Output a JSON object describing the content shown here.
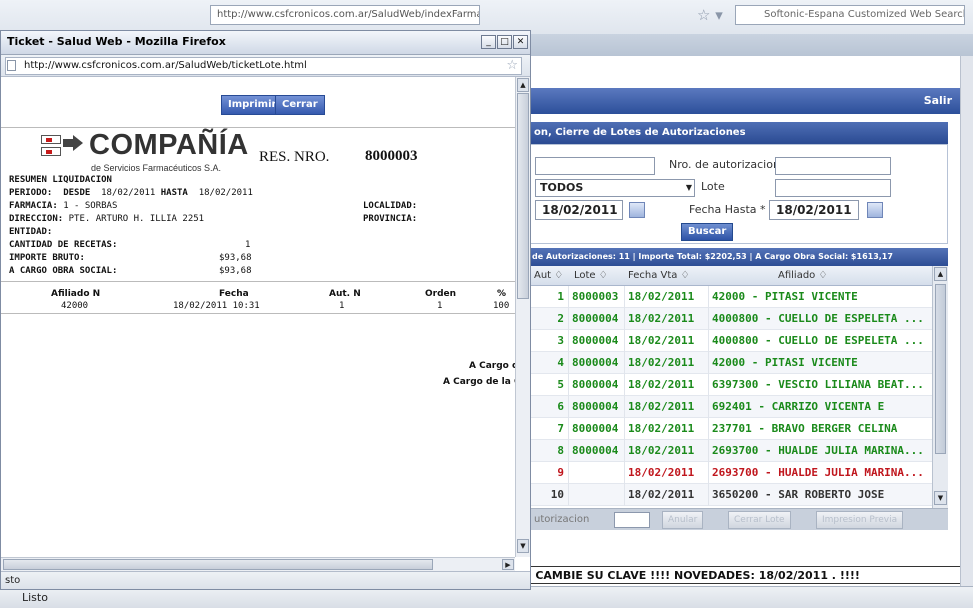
{
  "browser": {
    "url_fragment": "http://www.csfcronicos.com.ar/SaludWeb/indexFarmacia.html",
    "search_placeholder": "Softonic-Espana Customized Web Search",
    "status": "Listo"
  },
  "app": {
    "salir_label": "Salir",
    "panel_title": "on, Cierre de Lotes de Autorizaciones",
    "filters": {
      "nro_autorizacion_label": "Nro. de autorizacion",
      "select_value": "TODOS",
      "lote_label": "Lote",
      "fecha_desde_value": "18/02/2011",
      "fecha_hasta_label": "Fecha Hasta *",
      "fecha_hasta_value": "18/02/2011",
      "buscar_label": "Buscar"
    },
    "grid_title": "de Autorizaciones: 11 | Importe Total: $2202,53 | A Cargo Obra Social: $1613,17",
    "grid_columns": [
      "Aut ♢",
      "Lote ♢",
      "Fecha Vta ♢",
      "Afiliado ♢"
    ],
    "grid_rows": [
      {
        "aut": "1",
        "lote": "8000003",
        "fecha": "18/02/2011",
        "afiliado": "42000 - PITASI VICENTE",
        "status": "green"
      },
      {
        "aut": "2",
        "lote": "8000004",
        "fecha": "18/02/2011",
        "afiliado": "4000800 - CUELLO DE ESPELETA ...",
        "status": "green"
      },
      {
        "aut": "3",
        "lote": "8000004",
        "fecha": "18/02/2011",
        "afiliado": "4000800 - CUELLO DE ESPELETA ...",
        "status": "green"
      },
      {
        "aut": "4",
        "lote": "8000004",
        "fecha": "18/02/2011",
        "afiliado": "42000 - PITASI VICENTE",
        "status": "green"
      },
      {
        "aut": "5",
        "lote": "8000004",
        "fecha": "18/02/2011",
        "afiliado": "6397300 - VESCIO LILIANA BEAT...",
        "status": "green"
      },
      {
        "aut": "6",
        "lote": "8000004",
        "fecha": "18/02/2011",
        "afiliado": "692401 - CARRIZO VICENTA E",
        "status": "green"
      },
      {
        "aut": "7",
        "lote": "8000004",
        "fecha": "18/02/2011",
        "afiliado": "237701 - BRAVO BERGER CELINA",
        "status": "green"
      },
      {
        "aut": "8",
        "lote": "8000004",
        "fecha": "18/02/2011",
        "afiliado": "2693700 - HUALDE JULIA MARINA...",
        "status": "green"
      },
      {
        "aut": "9",
        "lote": "",
        "fecha": "18/02/2011",
        "afiliado": "2693700 - HUALDE JULIA MARINA...",
        "status": "red"
      },
      {
        "aut": "10",
        "lote": "",
        "fecha": "18/02/2011",
        "afiliado": "3650200 - SAR ROBERTO JOSE",
        "status": "dark"
      }
    ],
    "grid_footer": {
      "autorizacion_label": "utorizacion",
      "btn1": "Anular",
      "btn2": "Cerrar Lote",
      "btn3": "Impresion Previa"
    },
    "ticker": "E CAMBIE SU CLAVE !!!!     NOVEDADES: 18/02/2011 .  !!!!"
  },
  "popup": {
    "title": "Ticket - Salud Web - Mozilla Firefox",
    "url": "http://www.csfcronicos.com.ar/SaludWeb/ticketLote.html",
    "status": "sto",
    "imprimir_label": "Imprimir",
    "cerrar_label": "Cerrar",
    "company": "COMPAÑÍA",
    "company_sub": "de Servicios Farmacéuticos S.A.",
    "res_label": "RES. NRO.",
    "res_number": "8000003",
    "resumen": "RESUMEN LIQUIDACION",
    "periodo_label": "PERIODO:",
    "desde_label": "DESDE",
    "desde_value": "18/02/2011",
    "hasta_label": "HASTA",
    "hasta_value": "18/02/2011",
    "farmacia_label": "FARMACIA:",
    "farmacia_value": "1 - SORBAS",
    "direccion_label": "DIRECCION:",
    "direccion_value": "PTE. ARTURO H. ILLIA 2251",
    "localidad_label": "LOCALIDAD:",
    "provincia_label": "PROVINCIA:",
    "entidad_label": "ENTIDAD:",
    "cantidad_label": "CANTIDAD DE RECETAS:",
    "cantidad_value": "1",
    "importe_label": "IMPORTE BRUTO:",
    "importe_value": "$93,68",
    "cargo_label": "A CARGO OBRA SOCIAL:",
    "cargo_value": "$93,68",
    "table_headers": [
      "Afiliado N",
      "Fecha",
      "Aut. N",
      "Orden",
      "%"
    ],
    "table_row": [
      "42000",
      "18/02/2011 10:31",
      "1",
      "1",
      "100"
    ],
    "a_cargo_1": "A Cargo d",
    "a_cargo_2": "A Cargo de la O"
  },
  "colors": {
    "green": "#1a8a1a",
    "red": "#c0161d",
    "dark": "#333333",
    "blue_bar": "#2c4f9a"
  }
}
